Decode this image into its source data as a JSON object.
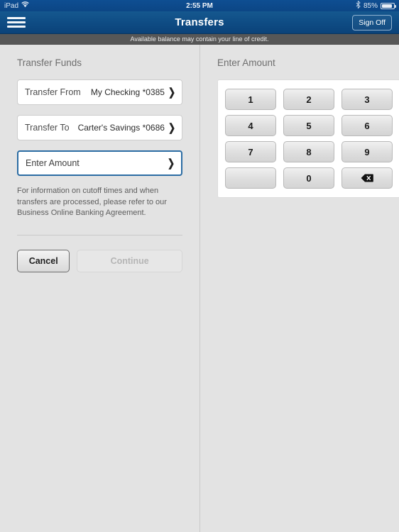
{
  "status_bar": {
    "device_label": "iPad",
    "wifi_icon": "wifi-icon",
    "time": "2:55 PM",
    "bluetooth_icon": "bluetooth-icon",
    "battery_percent": "85%",
    "battery_icon": "battery-icon",
    "battery_level": 85
  },
  "nav_bar": {
    "menu_icon": "hamburger-menu-icon",
    "title": "Transfers",
    "sign_off_label": "Sign Off",
    "background_color": "#0f4d85"
  },
  "notice": {
    "text": "Available balance may contain your line of credit.",
    "background_color": "#575757"
  },
  "left_pane": {
    "title": "Transfer Funds",
    "fields": [
      {
        "label": "Transfer From",
        "value": "My Checking *0385",
        "chevron": "chevron-right-icon",
        "active": false
      },
      {
        "label": "Transfer To",
        "value": "Carter's Savings *0686",
        "chevron": "chevron-right-icon",
        "active": false
      }
    ],
    "amount_field": {
      "label": "Enter Amount",
      "value": "",
      "chevron": "chevron-right-icon",
      "active": true,
      "focus_border_color": "#2b6ca3"
    },
    "disclaimer": "For information on cutoff times and when transfers are processed, please refer to our Business Online Banking Agreement.",
    "buttons": {
      "cancel_label": "Cancel",
      "cancel_enabled": true,
      "continue_label": "Continue",
      "continue_enabled": false
    }
  },
  "right_pane": {
    "title": "Enter Amount",
    "keypad": {
      "keys": [
        {
          "label": "1",
          "name": "key-1",
          "type": "digit"
        },
        {
          "label": "2",
          "name": "key-2",
          "type": "digit"
        },
        {
          "label": "3",
          "name": "key-3",
          "type": "digit"
        },
        {
          "label": "4",
          "name": "key-4",
          "type": "digit"
        },
        {
          "label": "5",
          "name": "key-5",
          "type": "digit"
        },
        {
          "label": "6",
          "name": "key-6",
          "type": "digit"
        },
        {
          "label": "7",
          "name": "key-7",
          "type": "digit"
        },
        {
          "label": "8",
          "name": "key-8",
          "type": "digit"
        },
        {
          "label": "9",
          "name": "key-9",
          "type": "digit"
        },
        {
          "label": "",
          "name": "key-blank",
          "type": "blank"
        },
        {
          "label": "0",
          "name": "key-0",
          "type": "digit"
        },
        {
          "label": "",
          "name": "key-backspace",
          "type": "backspace",
          "icon": "backspace-icon"
        }
      ]
    }
  }
}
